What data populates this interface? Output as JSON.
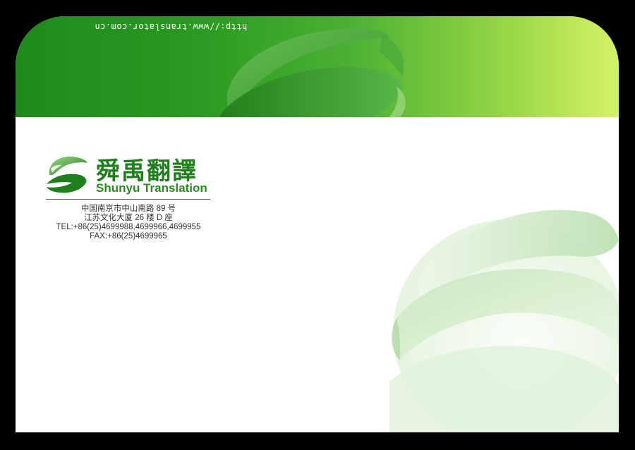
{
  "envelope": {
    "url": "http://www.translator.com.cn"
  },
  "brand": {
    "name_cn": "舜禹翻譯",
    "name_en": "Shunyu Translation"
  },
  "contact": {
    "address_line1": "中国南京市中山南路 89 号",
    "address_line2": "江苏文化大厦 26 楼 D 座",
    "tel": "TEL:+86(25)4699988,4699966,4699955",
    "fax": "FAX:+86(25)4699965"
  },
  "colors": {
    "brand_green": "#1e7f1c",
    "flap_light": "#d5f266",
    "background": "#000000"
  },
  "icons": [
    "logo-ribbon-icon",
    "watermark-ribbon-icon"
  ]
}
